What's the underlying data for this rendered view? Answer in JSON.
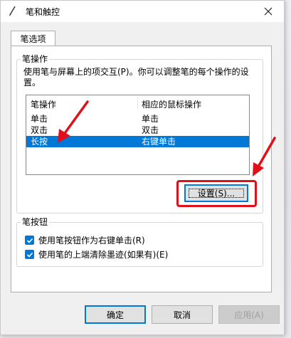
{
  "window": {
    "title": "笔和触控"
  },
  "tabs": [
    {
      "label": "笔选项"
    }
  ],
  "pen_actions": {
    "group_label": "笔操作",
    "description": "使用笔与屏幕上的项交互(P)。你可以调整笔的每个操作的设置。",
    "columns": [
      "笔操作",
      "相应的鼠标操作"
    ],
    "rows": [
      {
        "action": "单击",
        "mouse": "单击",
        "selected": false
      },
      {
        "action": "双击",
        "mouse": "双击",
        "selected": false
      },
      {
        "action": "长按",
        "mouse": "右键单击",
        "selected": true
      }
    ],
    "settings_button": "设置(S)..."
  },
  "pen_buttons": {
    "group_label": "笔按钮",
    "options": [
      {
        "label": "使用笔按钮作为右键单击(R)",
        "checked": true
      },
      {
        "label": "使用笔的上端清除墨迹(如果有)(E)",
        "checked": true
      }
    ]
  },
  "footer": {
    "ok": "确定",
    "cancel": "取消",
    "apply": "应用(A)"
  },
  "colors": {
    "accent": "#0078d7",
    "annotation": "#e0101a"
  }
}
